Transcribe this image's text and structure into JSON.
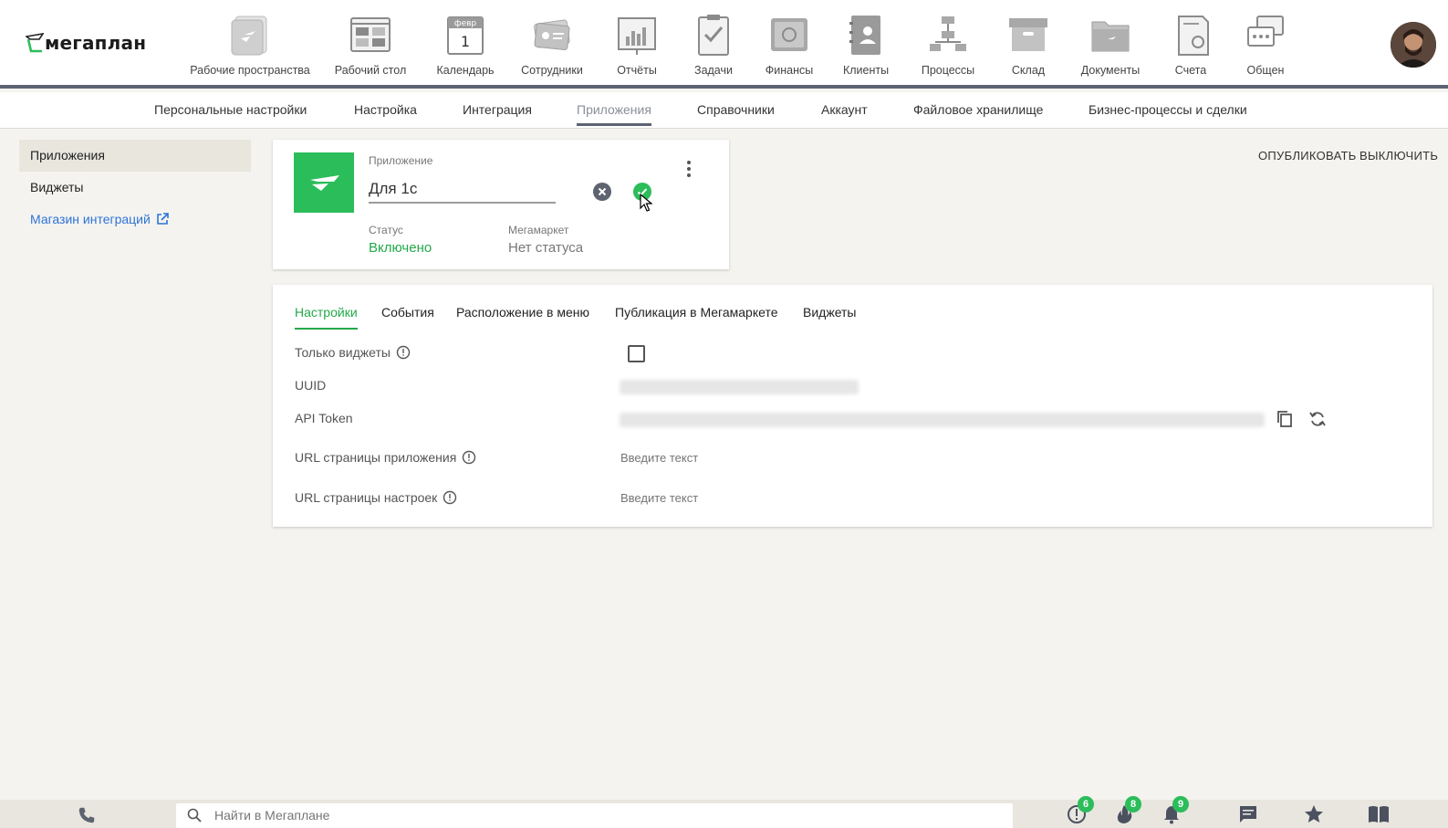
{
  "logo": {
    "text": "мегаплан"
  },
  "nav": [
    {
      "label": "Рабочие пространства",
      "icon": "workspaces-icon"
    },
    {
      "label": "Рабочий стол",
      "icon": "desktop-icon"
    },
    {
      "label": "Календарь",
      "icon": "calendar-icon",
      "month": "февр",
      "day": "1"
    },
    {
      "label": "Сотрудники",
      "icon": "employees-icon"
    },
    {
      "label": "Отчёты",
      "icon": "reports-icon"
    },
    {
      "label": "Задачи",
      "icon": "tasks-icon"
    },
    {
      "label": "Финансы",
      "icon": "finance-icon"
    },
    {
      "label": "Клиенты",
      "icon": "clients-icon"
    },
    {
      "label": "Процессы",
      "icon": "processes-icon"
    },
    {
      "label": "Склад",
      "icon": "warehouse-icon"
    },
    {
      "label": "Документы",
      "icon": "documents-icon"
    },
    {
      "label": "Счета",
      "icon": "invoices-icon"
    },
    {
      "label": "Общен",
      "icon": "chat-icon"
    }
  ],
  "subnav": [
    {
      "label": "Персональные настройки"
    },
    {
      "label": "Настройка"
    },
    {
      "label": "Интеграция"
    },
    {
      "label": "Приложения",
      "active": true
    },
    {
      "label": "Справочники"
    },
    {
      "label": "Аккаунт"
    },
    {
      "label": "Файловое хранилище"
    },
    {
      "label": "Бизнес-процессы и сделки"
    }
  ],
  "sidebar": {
    "items": [
      {
        "label": "Приложения",
        "active": true
      },
      {
        "label": "Виджеты"
      },
      {
        "label": "Магазин интеграций",
        "link": true
      }
    ]
  },
  "app": {
    "field_label": "Приложение",
    "name_value": "Для 1с",
    "status_label": "Статус",
    "status_value": "Включено",
    "market_label": "Мегамаркет",
    "market_value": "Нет статуса"
  },
  "actions": {
    "publish": "ОПУБЛИКОВАТЬ",
    "disable": "ВЫКЛЮЧИТЬ"
  },
  "tabs": [
    {
      "label": "Настройки",
      "active": true
    },
    {
      "label": "События"
    },
    {
      "label": "Расположение в меню"
    },
    {
      "label": "Публикация в Мегамаркете"
    },
    {
      "label": "Виджеты"
    }
  ],
  "settings": {
    "only_widgets_label": "Только виджеты",
    "uuid_label": "UUID",
    "api_token_label": "API Token",
    "app_url_label": "URL страницы приложения",
    "app_url_placeholder": "Введите текст",
    "settings_url_label": "URL страницы настроек",
    "settings_url_placeholder": "Введите текст"
  },
  "bottom": {
    "search_placeholder": "Найти в Мегаплане",
    "badges": {
      "alerts": "6",
      "hot": "8",
      "notifications": "9"
    }
  },
  "colors": {
    "accent_green": "#2bbd5a",
    "dark_bar": "#5c6373",
    "link_blue": "#2d74d8"
  }
}
